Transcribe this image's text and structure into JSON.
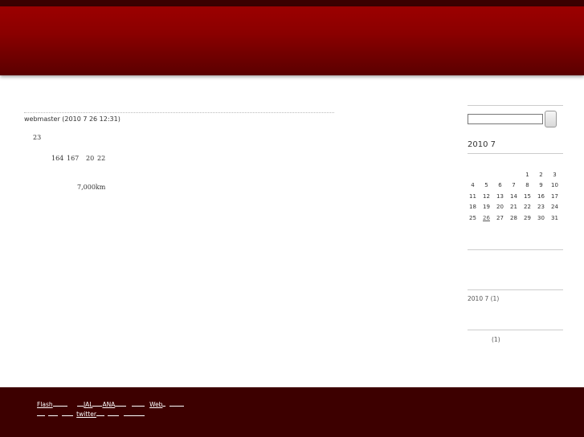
{
  "entry": {
    "meta": "webmaster (2010 7 26  12:31)",
    "line1": "23",
    "line2a": "164",
    "line2b": "167",
    "line2c": "20",
    "line2d": "22",
    "line3": "7,000km"
  },
  "sidebar": {
    "search": {
      "value": ""
    },
    "calendar": {
      "title": "2010 7",
      "weeks": [
        [
          "",
          "",
          "",
          "",
          "1",
          "2",
          "3"
        ],
        [
          "4",
          "5",
          "6",
          "7",
          "8",
          "9",
          "10"
        ],
        [
          "11",
          "12",
          "13",
          "14",
          "15",
          "16",
          "17"
        ],
        [
          "18",
          "19",
          "20",
          "21",
          "22",
          "23",
          "24"
        ],
        [
          "25",
          "26",
          "27",
          "28",
          "29",
          "30",
          "31"
        ]
      ],
      "linked_day": "26"
    },
    "archive_entry": "2010 7  (1)",
    "category_entry": "(1)"
  },
  "footer": {
    "links": {
      "flash": "Flash",
      "jal": "JAL",
      "ana": "ANA",
      "web": "Web",
      "twitter": "twitter"
    }
  }
}
